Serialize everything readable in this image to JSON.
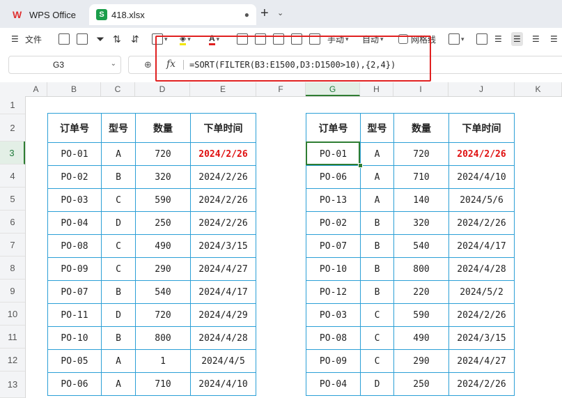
{
  "app": {
    "name": "WPS Office",
    "file_tab": "418.xlsx",
    "file_icon_letter": "S",
    "new_tab": "+"
  },
  "toolbar": {
    "file_label": "文件",
    "wrap_label": "手动",
    "auto_label": "自动",
    "gridlines_label": "网格线"
  },
  "formula_bar": {
    "cell_ref": "G3",
    "fx": "fx",
    "formula": "=SORT(FILTER(B3:E1500,D3:D1500>10),{2,4})"
  },
  "columns": [
    "A",
    "B",
    "C",
    "D",
    "E",
    "F",
    "G",
    "H",
    "I",
    "J",
    "K"
  ],
  "rows": [
    "1",
    "2",
    "3",
    "4",
    "5",
    "6",
    "7",
    "8",
    "9",
    "10",
    "11",
    "12",
    "13"
  ],
  "selected_cell": "G3",
  "left_table": {
    "headers": [
      "订单号",
      "型号",
      "数量",
      "下单时间"
    ],
    "rows": [
      [
        "PO-01",
        "A",
        "720",
        "2024/2/26"
      ],
      [
        "PO-02",
        "B",
        "320",
        "2024/2/26"
      ],
      [
        "PO-03",
        "C",
        "590",
        "2024/2/26"
      ],
      [
        "PO-04",
        "D",
        "250",
        "2024/2/26"
      ],
      [
        "PO-08",
        "C",
        "490",
        "2024/3/15"
      ],
      [
        "PO-09",
        "C",
        "290",
        "2024/4/27"
      ],
      [
        "PO-07",
        "B",
        "540",
        "2024/4/17"
      ],
      [
        "PO-11",
        "D",
        "720",
        "2024/4/29"
      ],
      [
        "PO-10",
        "B",
        "800",
        "2024/4/28"
      ],
      [
        "PO-05",
        "A",
        "1",
        "2024/4/5"
      ],
      [
        "PO-06",
        "A",
        "710",
        "2024/4/10"
      ]
    ]
  },
  "right_table": {
    "headers": [
      "订单号",
      "型号",
      "数量",
      "下单时间"
    ],
    "rows": [
      [
        "PO-01",
        "A",
        "720",
        "2024/2/26"
      ],
      [
        "PO-06",
        "A",
        "710",
        "2024/4/10"
      ],
      [
        "PO-13",
        "A",
        "140",
        "2024/5/6"
      ],
      [
        "PO-02",
        "B",
        "320",
        "2024/2/26"
      ],
      [
        "PO-07",
        "B",
        "540",
        "2024/4/17"
      ],
      [
        "PO-10",
        "B",
        "800",
        "2024/4/28"
      ],
      [
        "PO-12",
        "B",
        "220",
        "2024/5/2"
      ],
      [
        "PO-03",
        "C",
        "590",
        "2024/2/26"
      ],
      [
        "PO-08",
        "C",
        "490",
        "2024/3/15"
      ],
      [
        "PO-09",
        "C",
        "290",
        "2024/4/27"
      ],
      [
        "PO-04",
        "D",
        "250",
        "2024/2/26"
      ]
    ]
  },
  "colors": {
    "highlight_box": "#e02020",
    "date_highlight": "#e01010",
    "table_border": "#2b9fd6",
    "selection": "#2e7d32"
  }
}
